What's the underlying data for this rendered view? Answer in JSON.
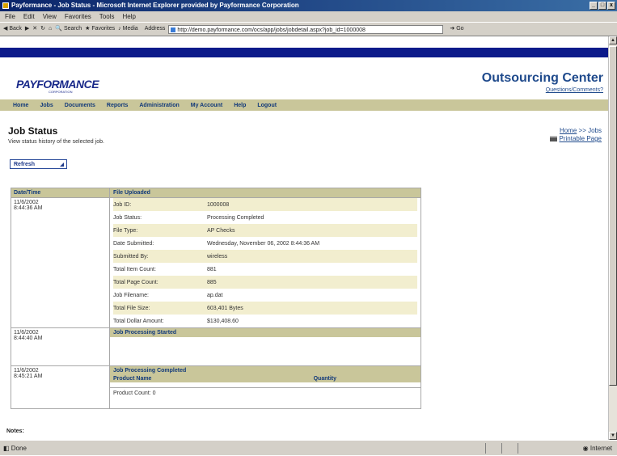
{
  "window": {
    "title": "Payformance - Job Status - Microsoft Internet Explorer provided by Payformance Corporation",
    "controls": [
      "_",
      "□",
      "x"
    ]
  },
  "menu": [
    "File",
    "Edit",
    "View",
    "Favorites",
    "Tools",
    "Help"
  ],
  "toolbar": {
    "back": "Back",
    "search": "Search",
    "favorites": "Favorites",
    "media": "Media",
    "address_label": "Address",
    "address": "http://demo.payformance.com/ocs/app/jobs/jobdetail.aspx?job_id=1000008",
    "go": "Go"
  },
  "header": {
    "logo": "PAYFORMANCE",
    "logo_sub": "CORPORATION",
    "title": "Outsourcing Center",
    "link": "Questions/Comments?"
  },
  "nav": [
    "Home",
    "Jobs",
    "Documents",
    "Reports",
    "Administration",
    "My Account",
    "Help",
    "Logout"
  ],
  "page": {
    "title": "Job Status",
    "subtitle": "View status history of the selected job.",
    "crumb_home": "Home",
    "crumb_sep": " >> ",
    "crumb_current": "Jobs",
    "printable": "Printable Page",
    "refresh": "Refresh"
  },
  "table": {
    "col_date": "Date/Time",
    "rows": [
      {
        "date": "11/6/2002",
        "time": "8:44:36 AM",
        "event": "File Uploaded",
        "details": [
          {
            "k": "Job ID:",
            "v": "1000008"
          },
          {
            "k": "Job Status:",
            "v": "Processing Completed"
          },
          {
            "k": "File Type:",
            "v": "AP Checks"
          },
          {
            "k": "Date Submitted:",
            "v": "Wednesday, November 06, 2002 8:44:36 AM"
          },
          {
            "k": "Submitted By:",
            "v": "wireless"
          },
          {
            "k": "Total Item Count:",
            "v": "881"
          },
          {
            "k": "Total Page Count:",
            "v": "885"
          },
          {
            "k": "Job Filename:",
            "v": "ap.dat"
          },
          {
            "k": "Total File Size:",
            "v": "603,401 Bytes"
          },
          {
            "k": "Total Dollar Amount:",
            "v": "$130,408.60"
          }
        ]
      },
      {
        "date": "11/6/2002",
        "time": "8:44:40 AM",
        "event": "Job Processing Started"
      },
      {
        "date": "11/6/2002",
        "time": "8:45:21 AM",
        "event": "Job Processing Completed",
        "product_name": "Product Name",
        "quantity": "Quantity",
        "product_count": "Product Count: 0"
      }
    ]
  },
  "notes": "Notes:",
  "status": {
    "left": "Done",
    "right": "Internet"
  }
}
